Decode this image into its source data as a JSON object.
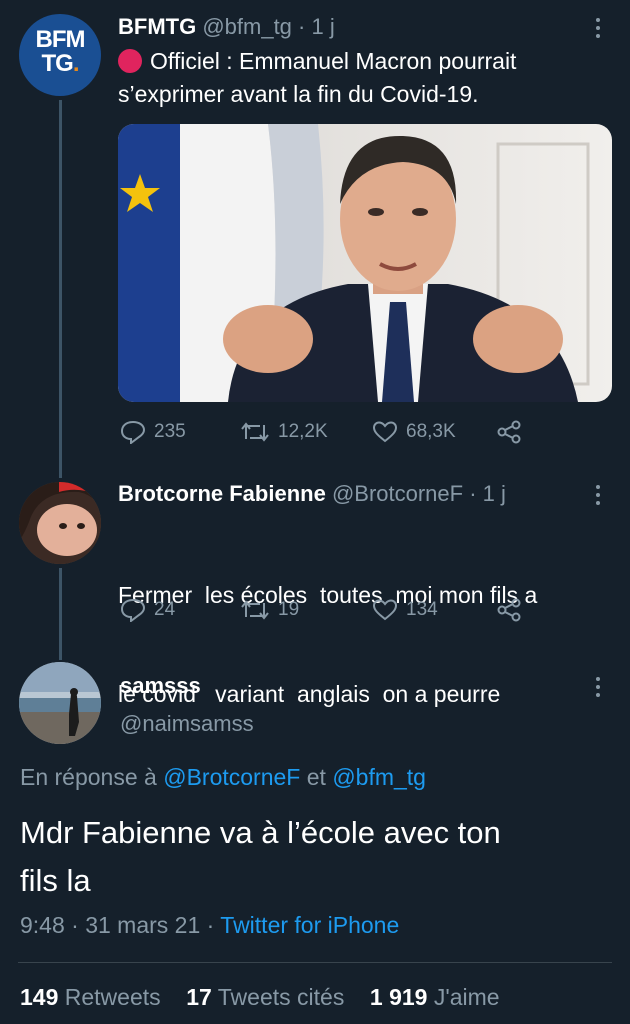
{
  "colors": {
    "background": "#15202b",
    "text": "#ffffff",
    "muted": "#8899a6",
    "link": "#1d9bf0",
    "live_dot": "#e0245e",
    "avatar_bfm": "#1a4f93"
  },
  "tweet1": {
    "avatar_text_line1": "BFM",
    "avatar_text_line2": "TG",
    "name": "BFMTG",
    "handle": "@bfm_tg",
    "time": "· 1 j",
    "text_line1": "Officiel : Emmanuel Macron pourrait",
    "text_line2": "s’exprimer avant la fin du Covid-19.",
    "replies": "235",
    "retweets": "12,2K",
    "likes": "68,3K"
  },
  "tweet2": {
    "name": "Brotcorne Fabienne",
    "handle": "@BrotcorneF",
    "time": "· 1 j",
    "text_line1": "Fermer  les écoles  toutes  moi mon fils a",
    "text_line2": "le covid   variant  anglais  on a peurre",
    "replies": "24",
    "retweets": "19",
    "likes": "134"
  },
  "main_tweet": {
    "name": "samsss",
    "handle": "@naimsamss",
    "reply_prefix": "En réponse à",
    "reply_user1": "@BrotcorneF",
    "reply_and": "et",
    "reply_user2": "@bfm_tg",
    "text_line1": "Mdr Fabienne va à l’école avec ton",
    "text_line2": "fils la",
    "time": "9:48 · 31 mars 21 ·",
    "source": "Twitter for iPhone",
    "retweets_count": "149",
    "retweets_label": "Retweets",
    "quotes_count": "17",
    "quotes_label": "Tweets cités",
    "likes_count": "1 919",
    "likes_label": "J'aime"
  }
}
